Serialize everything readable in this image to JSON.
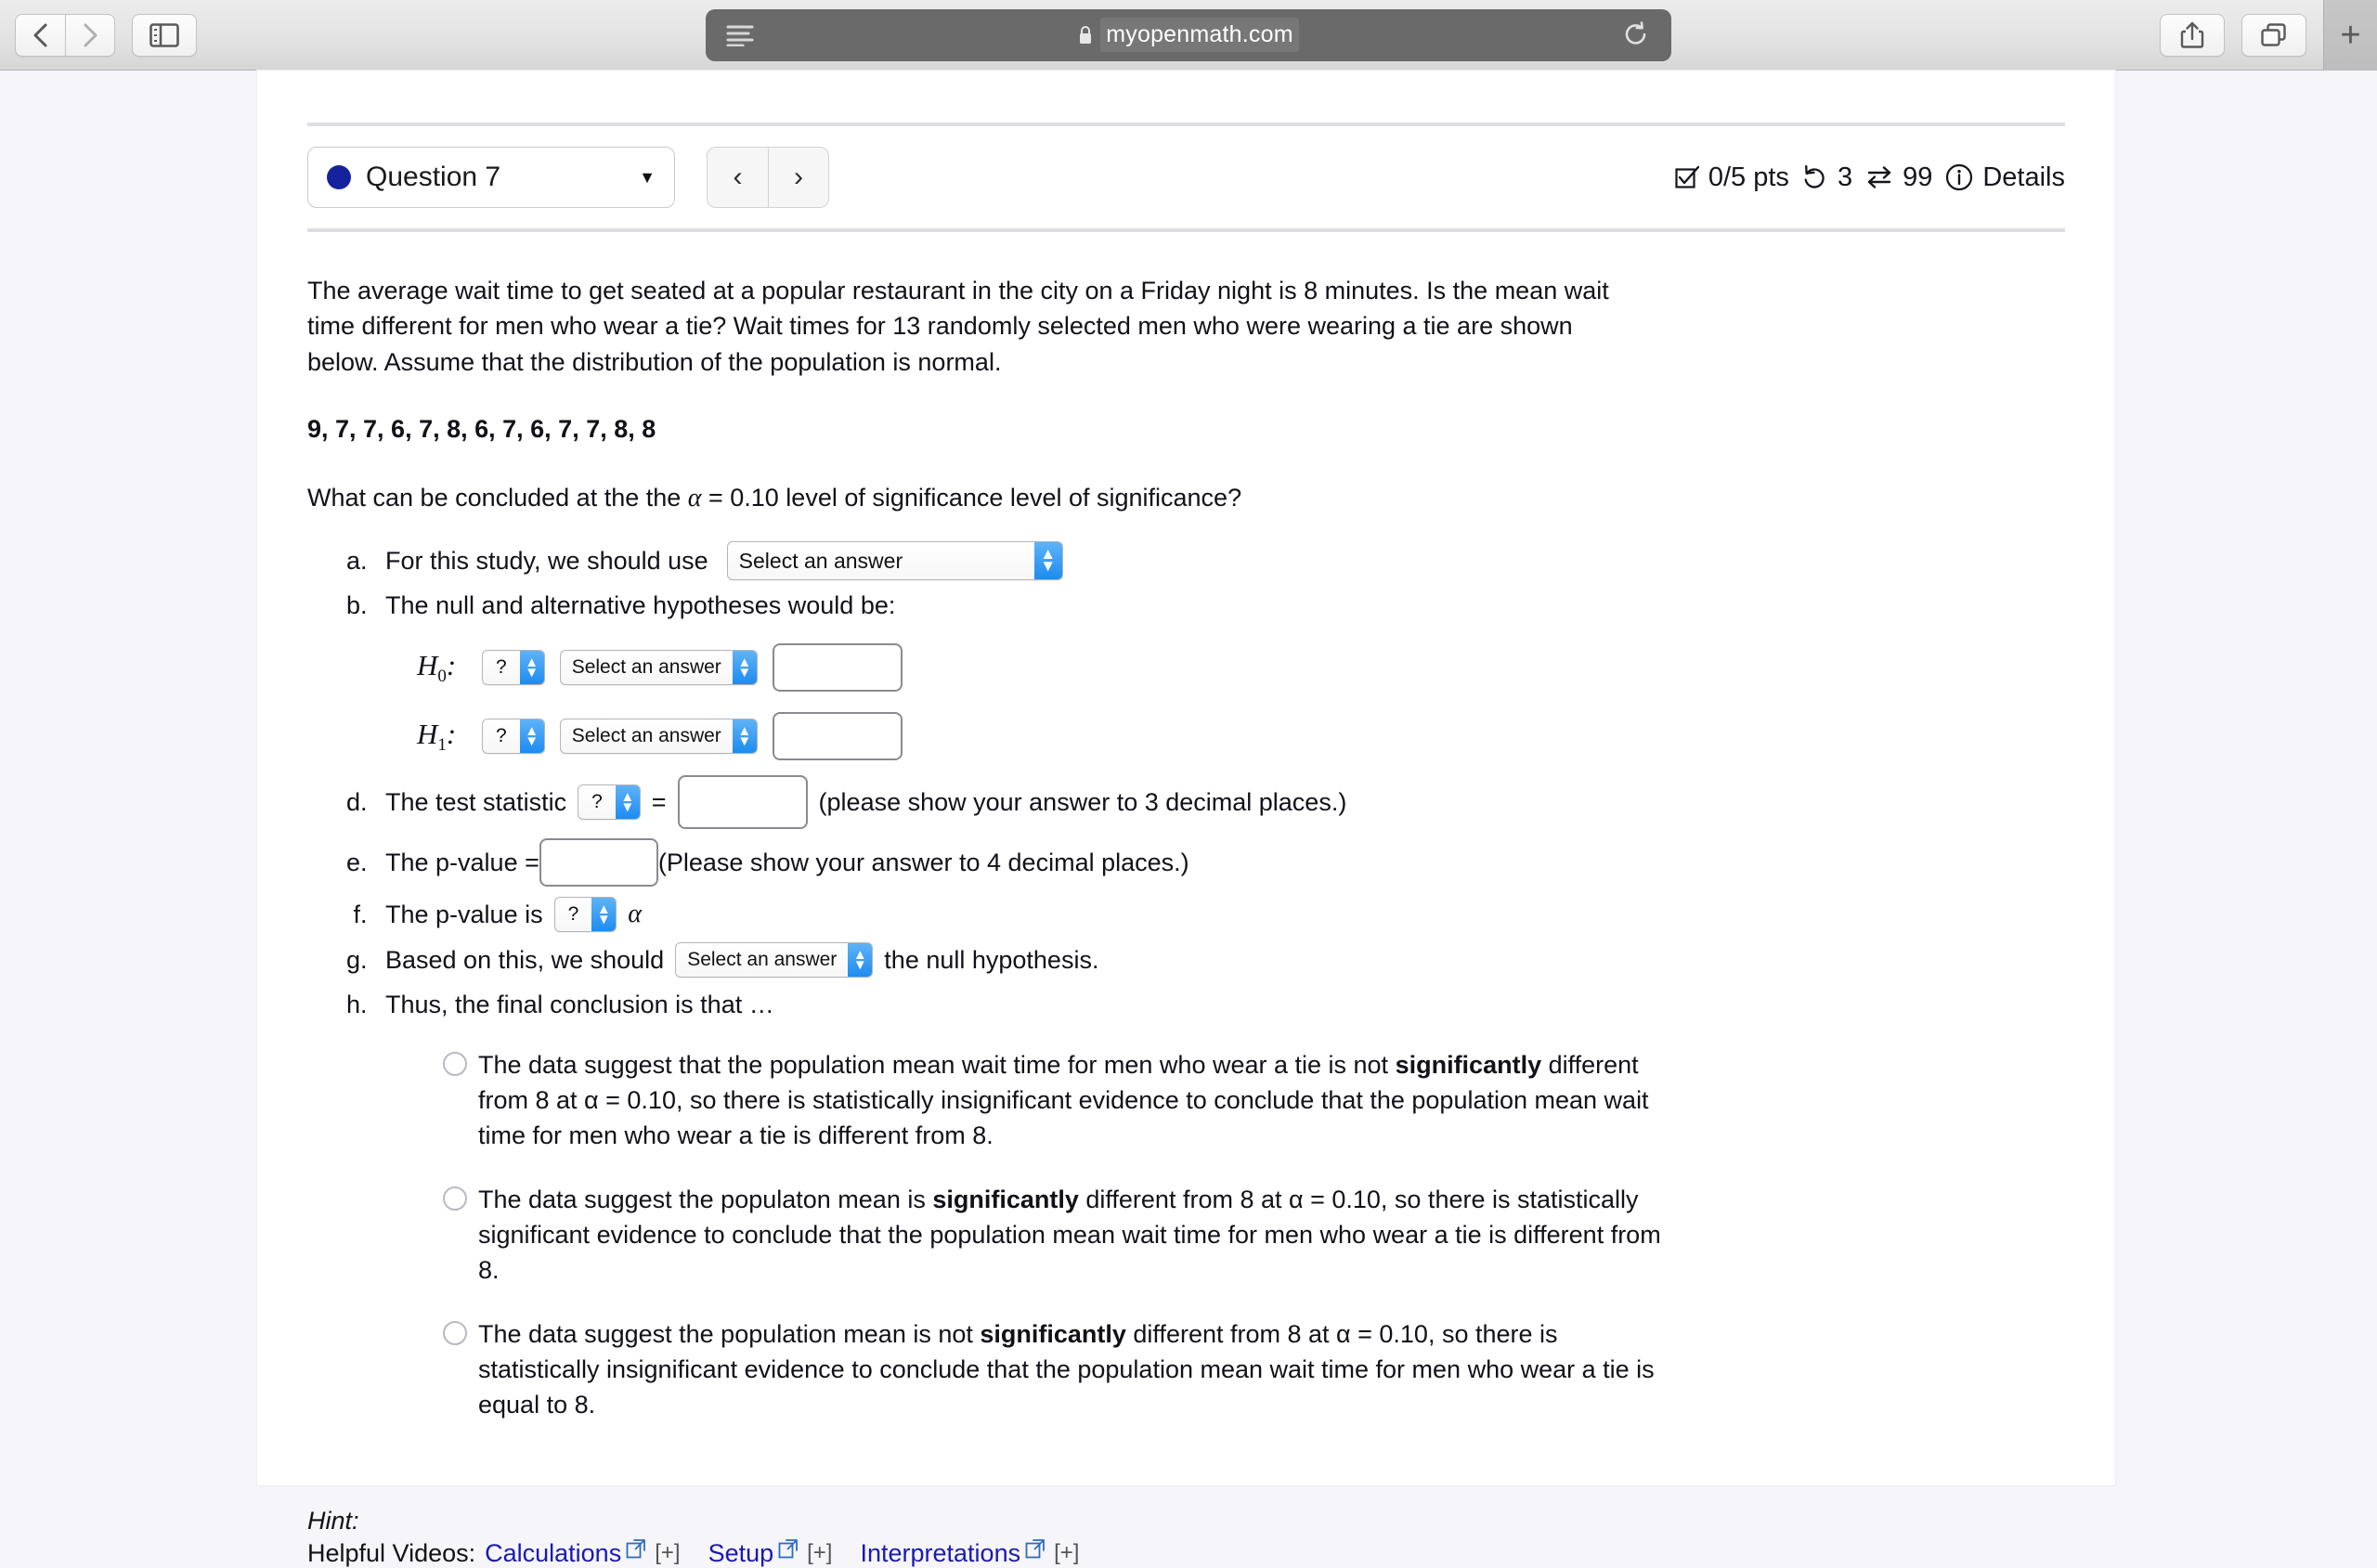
{
  "browser": {
    "back_icon": "chevron-left",
    "forward_icon": "chevron-right",
    "sidebar_icon": "sidebar",
    "reader_icon": "reader-view",
    "lock_icon": "lock",
    "url": "myopenmath.com",
    "reload_icon": "reload",
    "share_icon": "share",
    "tabs_icon": "tab-overview",
    "newtab_label": "+"
  },
  "question_header": {
    "selector_label": "Question 7",
    "selector_caret": "▼",
    "prev_label": "‹",
    "next_label": "›",
    "points": "0/5 pts",
    "attempts": "3",
    "versions": "99",
    "details_label": "Details",
    "dot_color": "#14239c"
  },
  "question": {
    "prompt": "The average wait time to get seated at a popular restaurant in the city on a Friday night is 8 minutes.  Is the mean wait time different for men who wear a tie? Wait times for 13 randomly selected men who were wearing a tie are shown below. Assume that the distribution of the population is normal.",
    "data_values": "9, 7, 7, 6, 7, 8, 6, 7, 6, 7, 7, 8, 8",
    "alpha_question_pre": "What can be concluded at the the ",
    "alpha_symbol": "α",
    "alpha_question_post": " = 0.10 level of significance level of significance?"
  },
  "parts": {
    "a": {
      "text": "For this study, we should use",
      "select_value": "Select an answer"
    },
    "b": {
      "text": "The null and alternative hypotheses would be:",
      "h0_label": "H",
      "h0_sub": "0",
      "h1_label": "H",
      "h1_sub": "1",
      "colon": ":",
      "op_value": "?",
      "select_value": "Select an answer",
      "value_input": ""
    },
    "c": {
      "text_pre": "The test statistic",
      "stat_value": "?",
      "equals": "=",
      "input_value": "",
      "text_post": "(please show your answer to 3 decimal places.)"
    },
    "d": {
      "text_pre": "The p-value =",
      "input_value": "",
      "text_post": "(Please show your answer to 4 decimal places.)"
    },
    "e": {
      "text_pre": "The p-value is",
      "compare_value": "?",
      "alpha_symbol": "α"
    },
    "f": {
      "text_pre": "Based on this, we should",
      "select_value": "Select an answer",
      "text_post": "the null hypothesis."
    },
    "g": {
      "text": "Thus, the final conclusion is that …",
      "choices": [
        {
          "pre": "The data suggest that the population mean wait time for men who wear a tie is not ",
          "bold": "significantly",
          "post": " different from 8 at α = 0.10, so there is statistically insignificant evidence to conclude that the population mean wait time for men who wear a tie is different from 8.",
          "selected": false
        },
        {
          "pre": "The data suggest the populaton mean is ",
          "bold": "significantly",
          "post": " different from 8 at α = 0.10, so there is statistically significant evidence to conclude that the population mean wait time for men who wear a tie is different from 8.",
          "selected": false
        },
        {
          "pre": "The data suggest the population mean is not ",
          "bold": "significantly",
          "post": " different from 8 at α = 0.10, so there is statistically insignificant evidence to conclude that the population mean wait time for men who wear a tie is equal to 8.",
          "selected": false
        }
      ]
    }
  },
  "hint": {
    "label": "Hint:",
    "videos_label": "Helpful Videos:",
    "links": [
      {
        "label": "Calculations",
        "toggle": "[+]"
      },
      {
        "label": "Setup",
        "toggle": "[+]"
      },
      {
        "label": "Interpretations",
        "toggle": "[+]"
      }
    ],
    "link_color": "#1a1ab0"
  }
}
